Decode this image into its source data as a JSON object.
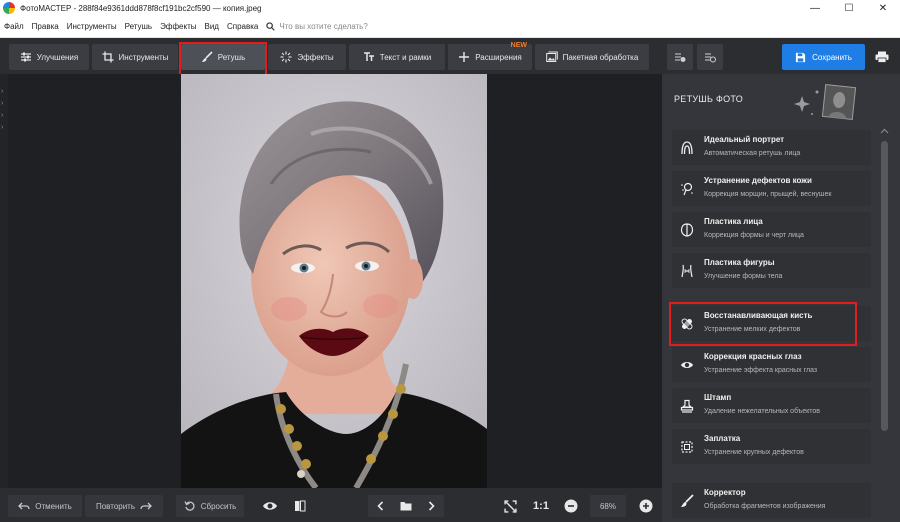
{
  "window": {
    "title": "ФотоМАСТЕР - 288f84e9361ddd878f8cf191bc2cf590 — копия.jpeg",
    "controls": [
      "—",
      "☐",
      "✕"
    ]
  },
  "menu": {
    "items": [
      "Файл",
      "Правка",
      "Инструменты",
      "Ретушь",
      "Эффекты",
      "Вид",
      "Справка"
    ],
    "search_placeholder": "Что вы хотите сделать?"
  },
  "toolbar": {
    "tabs": [
      {
        "label": "Улучшения",
        "icon": "sliders-icon"
      },
      {
        "label": "Инструменты",
        "icon": "crop-icon"
      },
      {
        "label": "Ретушь",
        "icon": "brush-icon",
        "active": true
      },
      {
        "label": "Эффекты",
        "icon": "sparkle-icon"
      },
      {
        "label": "Текст и рамки",
        "icon": "text-icon"
      },
      {
        "label": "Расширения",
        "icon": "plus-icon",
        "badge": "NEW"
      },
      {
        "label": "Пакетная обработка",
        "icon": "images-icon"
      }
    ],
    "save_label": "Сохранить",
    "accent_color": "#1e7ee6",
    "highlight_color": "#e21d1d"
  },
  "bottom": {
    "undo_label": "Отменить",
    "redo_label": "Повторить",
    "reset_label": "Сбросить",
    "ratio_label": "1:1",
    "zoom": "68%"
  },
  "panel": {
    "title": "РЕТУШЬ ФОТО",
    "tools": [
      {
        "title": "Идеальный портрет",
        "subtitle": "Автоматическая ретушь лица",
        "icon": "portrait-icon"
      },
      {
        "title": "Устранение дефектов кожи",
        "subtitle": "Коррекция морщин, прыщей, веснушек",
        "icon": "skin-defects-icon"
      },
      {
        "title": "Пластика лица",
        "subtitle": "Коррекция формы и черт лица",
        "icon": "face-shape-icon"
      },
      {
        "title": "Пластика фигуры",
        "subtitle": "Улучшение формы тела",
        "icon": "body-shape-icon"
      },
      {
        "title": "Восстанавливающая кисть",
        "subtitle": "Устранение мелких дефектов",
        "icon": "healing-brush-icon",
        "highlighted": true
      },
      {
        "title": "Коррекция красных глаз",
        "subtitle": "Устранение эффекта красных глаз",
        "icon": "eye-icon"
      },
      {
        "title": "Штамп",
        "subtitle": "Удаление нежелательных объектов",
        "icon": "stamp-icon"
      },
      {
        "title": "Заплатка",
        "subtitle": "Устранение крупных дефектов",
        "icon": "patch-icon"
      },
      {
        "title": "Корректор",
        "subtitle": "Обработка фрагментов изображения",
        "icon": "corrector-brush-icon"
      }
    ]
  }
}
